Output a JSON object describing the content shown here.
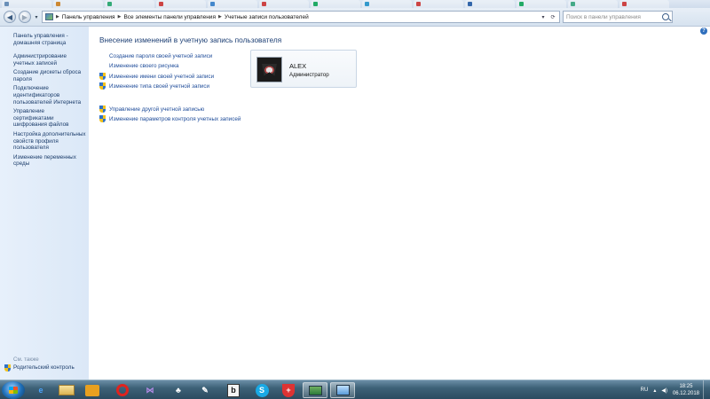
{
  "address": {
    "crumbs": [
      "Панель управления",
      "Все элементы панели управления",
      "Учетные записи пользователей"
    ],
    "search_placeholder": "Поиск в панели управления"
  },
  "left_panel": {
    "home": "Панель управления - домашняя страница",
    "links": [
      "Администрирование учетных записей",
      "Создание дискеты сброса пароля",
      "Подключение идентификаторов пользователей Интернета",
      "Управление сертификатами шифрования файлов",
      "Настройка дополнительных свойств профиля пользователя",
      "Изменение переменных среды"
    ],
    "see_also": "См. также",
    "parental": "Родительский контроль"
  },
  "main": {
    "heading": "Внесение изменений в учетную запись пользователя",
    "tasks": [
      {
        "label": "Создание пароля своей учетной записи",
        "shield": false
      },
      {
        "label": "Изменение своего рисунка",
        "shield": false
      },
      {
        "label": "Изменение имени своей учетной записи",
        "shield": true
      },
      {
        "label": "Изменение типа своей учетной записи",
        "shield": true
      }
    ],
    "other_tasks": [
      {
        "label": "Управление другой учетной записью",
        "shield": true
      },
      {
        "label": "Изменение параметров контроля учетных записей",
        "shield": true
      }
    ]
  },
  "account": {
    "name": "ALEX",
    "role": "Администратор"
  },
  "taskbar": {
    "apps": [
      "internet-explorer",
      "file-explorer",
      "media-player",
      "opera",
      "visual-studio",
      "game",
      "paint",
      "notepad",
      "skype",
      "shield-app",
      "control-panel-window",
      "network-window"
    ],
    "language": "RU",
    "time": "18:25",
    "date": "06.12.2018"
  },
  "colors": {
    "link": "#1c4a98",
    "heading": "#1d3f74",
    "left_panel_bg": "#e4eefa"
  }
}
